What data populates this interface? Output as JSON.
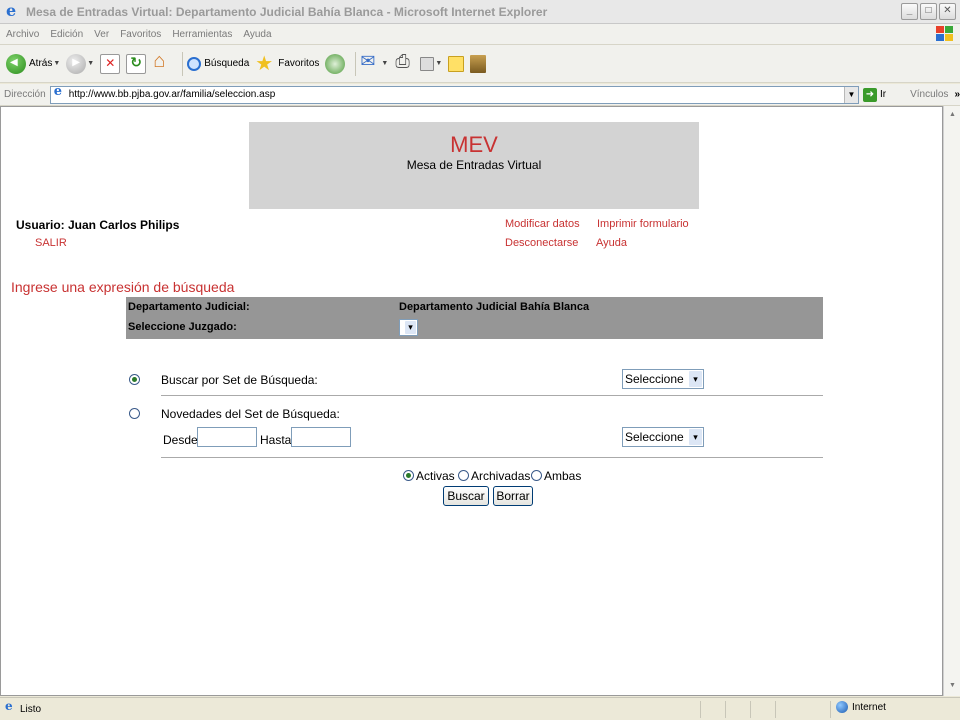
{
  "window": {
    "title": "Mesa de Entradas Virtual: Departamento Judicial Bahía Blanca - Microsoft Internet Explorer",
    "min": "_",
    "max": "□",
    "close": "✕"
  },
  "menu": [
    "Archivo",
    "Edición",
    "Ver",
    "Favoritos",
    "Herramientas",
    "Ayuda"
  ],
  "toolbar": {
    "back": "Atrás",
    "search": "Búsqueda",
    "favorites": "Favoritos"
  },
  "address": {
    "label": "Dirección",
    "url": "http://www.bb.pjba.gov.ar/familia/seleccion.asp",
    "go": "Ir",
    "links": "Vínculos",
    "links_more": "»"
  },
  "page": {
    "banner_title": "MEV",
    "banner_subtitle": "Mesa de Entradas Virtual",
    "user": "Usuario: Juan Carlos Philips",
    "salir": "SALIR",
    "modificar": "Modificar datos",
    "imprimir": "Imprimir formulario",
    "desconectarse": "Desconectarse",
    "ayuda": "Ayuda",
    "section_title": "Ingrese una expresión de búsqueda",
    "dept_label": "Departamento Judicial:",
    "dept_value": "Departamento Judicial Bahía Blanca",
    "juzgado_label": "Seleccione Juzgado:",
    "buscar_set": "Buscar por Set de Búsqueda:",
    "select1_value": "Seleccione",
    "novedades": "Novedades del Set de Búsqueda:",
    "desde": "Desde:",
    "hasta": "Hasta:",
    "select2_value": "Seleccione",
    "activas": "Activas",
    "archivadas": "Archivadas",
    "ambas": "Ambas",
    "buscar_btn": "Buscar",
    "borrar_btn": "Borrar"
  },
  "status": {
    "text": "Listo",
    "zone": "Internet"
  }
}
